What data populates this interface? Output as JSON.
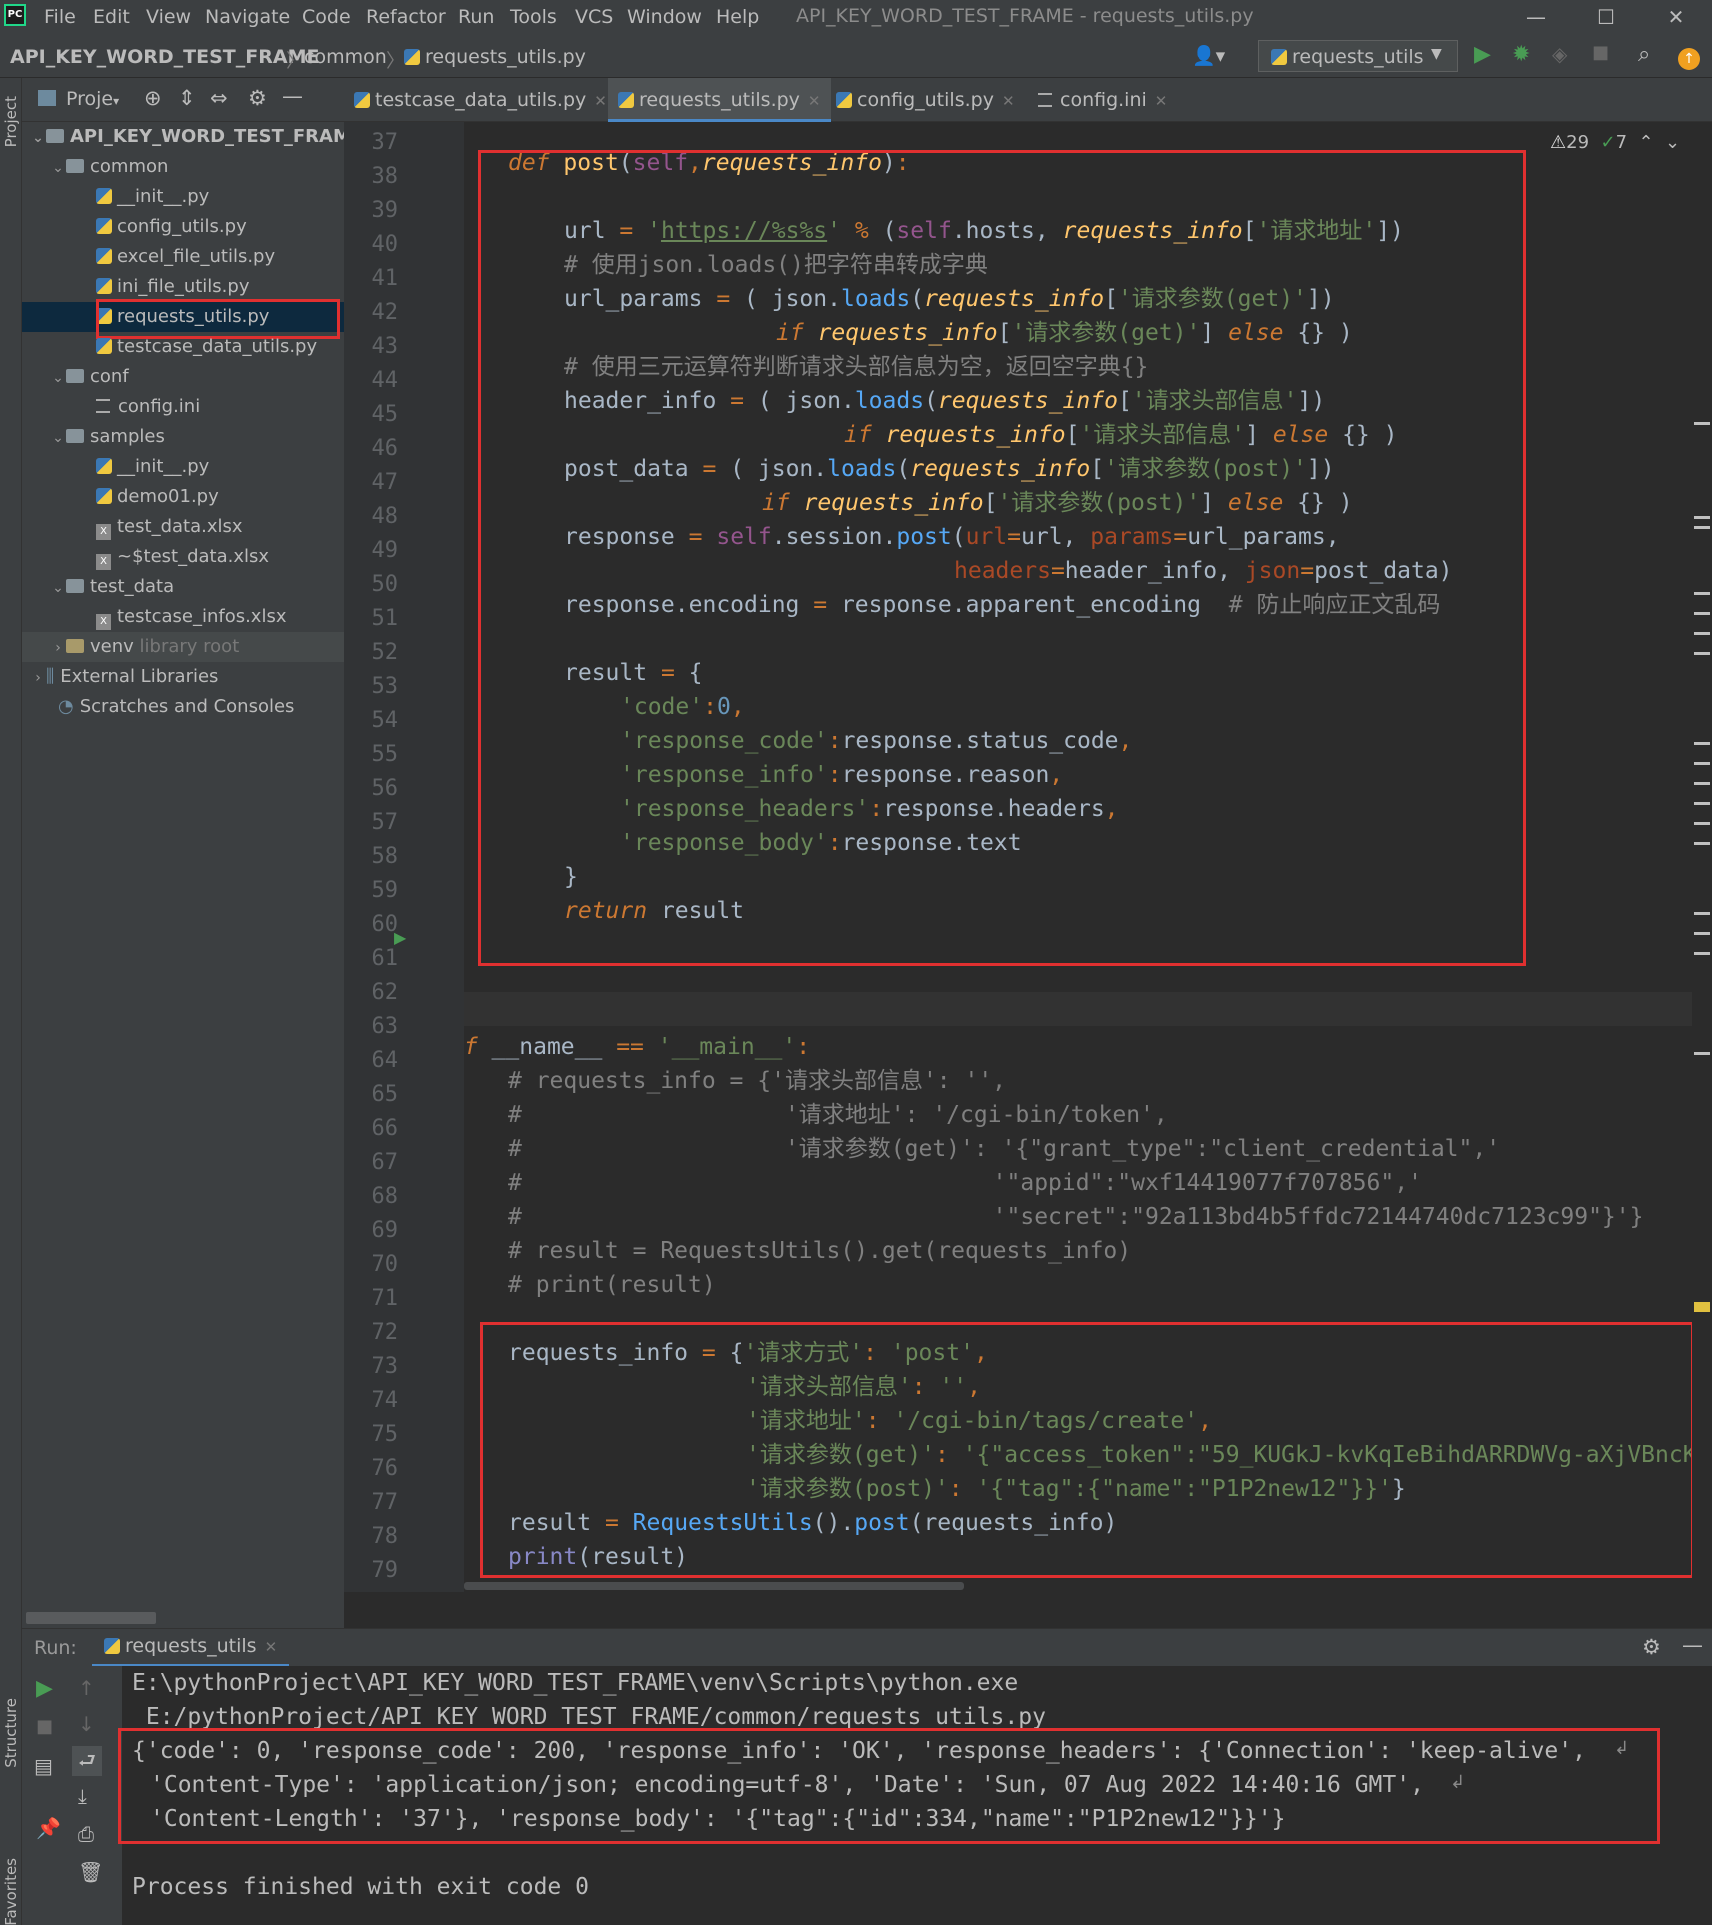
{
  "app": {
    "window_title": "API_KEY_WORD_TEST_FRAME - requests_utils.py",
    "logo_text": "PC",
    "menu": [
      "File",
      "Edit",
      "View",
      "Navigate",
      "Code",
      "Refactor",
      "Run",
      "Tools",
      "VCS",
      "Window",
      "Help"
    ]
  },
  "navbar": {
    "project": "API_KEY_WORD_TEST_FRAME",
    "folder": "common",
    "file": "requests_utils.py",
    "run_config": "requests_utils"
  },
  "project_panel": {
    "header": "Proje",
    "strip_label": "Project",
    "items": [
      {
        "label": "API_KEY_WORD_TEST_FRAM",
        "kind": "root"
      },
      {
        "label": "common",
        "kind": "folder"
      },
      {
        "label": "__init__.py",
        "kind": "py"
      },
      {
        "label": "config_utils.py",
        "kind": "py"
      },
      {
        "label": "excel_file_utils.py",
        "kind": "py"
      },
      {
        "label": "ini_file_utils.py",
        "kind": "py"
      },
      {
        "label": "requests_utils.py",
        "kind": "py"
      },
      {
        "label": "testcase_data_utils.py",
        "kind": "py"
      },
      {
        "label": "conf",
        "kind": "folder"
      },
      {
        "label": "config.ini",
        "kind": "ini"
      },
      {
        "label": "samples",
        "kind": "folder"
      },
      {
        "label": "__init__.py",
        "kind": "py"
      },
      {
        "label": "demo01.py",
        "kind": "py"
      },
      {
        "label": "test_data.xlsx",
        "kind": "xls"
      },
      {
        "label": "~$test_data.xlsx",
        "kind": "xls"
      },
      {
        "label": "test_data",
        "kind": "folder"
      },
      {
        "label": "testcase_infos.xlsx",
        "kind": "xls"
      },
      {
        "label": "venv",
        "kind": "folder"
      },
      {
        "label": "library root",
        "kind": "hint"
      },
      {
        "label": "External Libraries",
        "kind": "lib"
      },
      {
        "label": "Scratches and Consoles",
        "kind": "scratch"
      }
    ]
  },
  "tabs": [
    {
      "label": "testcase_data_utils.py"
    },
    {
      "label": "requests_utils.py"
    },
    {
      "label": "config_utils.py"
    },
    {
      "label": "config.ini"
    }
  ],
  "inspections": {
    "warnings": "29",
    "typos": "7"
  },
  "line_numbers": [
    "37",
    "38",
    "39",
    "40",
    "41",
    "42",
    "43",
    "44",
    "45",
    "46",
    "47",
    "48",
    "49",
    "50",
    "51",
    "52",
    "53",
    "54",
    "55",
    "56",
    "57",
    "58",
    "59",
    "60",
    "61",
    "62",
    "63",
    "64",
    "65",
    "66",
    "67",
    "68",
    "69",
    "70",
    "71",
    "72",
    "73",
    "74",
    "75",
    "76",
    "77",
    "78",
    "79"
  ],
  "code": {
    "l38_def": "def",
    "l38_name": "post",
    "l38_self": "self",
    "l38_param": "requests_info",
    "l40_url": "https://%s%s",
    "l40_attr": "hosts",
    "l40_key": "'请求地址'",
    "l41_comment": "# 使用json.loads()把字符串转成字典",
    "l42_key": "'请求参数(get)'",
    "l43_key": "'请求参数(get)'",
    "l44_comment": "# 使用三元运算符判断请求头部信息为空，返回空字典{}",
    "l45_key": "'请求头部信息'",
    "l46_key": "'请求头部信息'",
    "l47_key": "'请求参数(post)'",
    "l48_key": "'请求参数(post)'",
    "l51_comment": "# 防止响应正文乱码",
    "l64_comment": "# requests_info = {'请求头部信息': '',",
    "l65_comment": "#                   '请求地址': '/cgi-bin/token',",
    "l66_comment": "#                   '请求参数(get)': '{\"grant_type\":\"client_credential\",'",
    "l67_comment": "#                                  '\"appid\":\"wxf14419077f707856\",'",
    "l68_comment": "#                                  '\"secret\":\"92a113bd4b5ffdc72144740dc7123c99\"}'}",
    "l69_comment": "# result = RequestsUtils().get(requests_info)",
    "l70_comment": "# print(result)",
    "l72_k": "'请求方式'",
    "l72_v": "'post'",
    "l73_k": "'请求头部信息'",
    "l73_v": "''",
    "l74_k": "'请求地址'",
    "l74_v": "'/cgi-bin/tags/create'",
    "l75_k": "'请求参数(get)'",
    "l75_v": "'{\"access_token\":\"59_KUGkJ-kvKqIeBihdARRDWVg-aXjVBncK",
    "l76_k": "'请求参数(post)'",
    "l76_v": "'{\"tag\":{\"name\":\"P1P2new12\"}}'"
  },
  "run": {
    "label": "Run:",
    "config": "requests_utils",
    "lines": [
      "E:\\pythonProject\\API_KEY_WORD_TEST_FRAME\\venv\\Scripts\\python.exe",
      " E:/pythonProject/API_KEY_WORD_TEST_FRAME/common/requests_utils.py",
      "{'code': 0, 'response_code': 200, 'response_info': 'OK', 'response_headers': {'Connection': 'keep-alive', ",
      "'Content-Type': 'application/json; encoding=utf-8', 'Date': 'Sun, 07 Aug 2022 14:40:16 GMT', ",
      "'Content-Length': '37'}, 'response_body': '{\"tag\":{\"id\":334,\"name\":\"P1P2new12\"}}'}",
      "Process finished with exit code 0"
    ]
  },
  "side_labels": {
    "structure": "Structure",
    "favorites": "Favorites"
  },
  "colors": {
    "accent": "#4a88c7",
    "highlight_box": "#e03030",
    "run_green": "#499c54"
  }
}
